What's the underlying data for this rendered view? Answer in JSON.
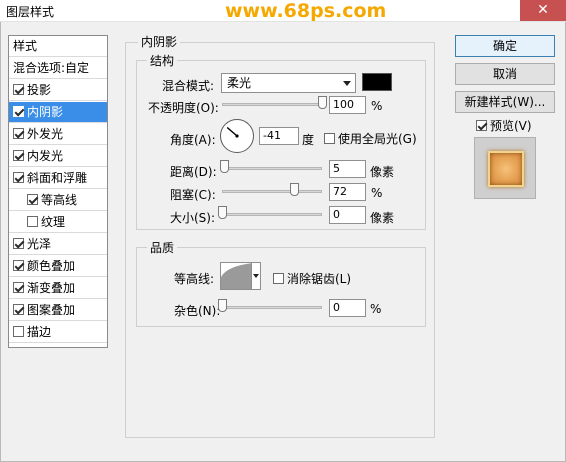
{
  "window": {
    "title": "图层样式",
    "watermark": "www.68ps.com",
    "close_label": "✕"
  },
  "left_panel": {
    "items": [
      {
        "label": "样式",
        "checkbox": false,
        "checked": false,
        "selected": false,
        "indent": false
      },
      {
        "label": "混合选项:自定",
        "checkbox": false,
        "checked": false,
        "selected": false,
        "indent": false
      },
      {
        "label": "投影",
        "checkbox": true,
        "checked": true,
        "selected": false,
        "indent": false
      },
      {
        "label": "内阴影",
        "checkbox": true,
        "checked": true,
        "selected": true,
        "indent": false
      },
      {
        "label": "外发光",
        "checkbox": true,
        "checked": true,
        "selected": false,
        "indent": false
      },
      {
        "label": "内发光",
        "checkbox": true,
        "checked": true,
        "selected": false,
        "indent": false
      },
      {
        "label": "斜面和浮雕",
        "checkbox": true,
        "checked": true,
        "selected": false,
        "indent": false
      },
      {
        "label": "等高线",
        "checkbox": true,
        "checked": true,
        "selected": false,
        "indent": true
      },
      {
        "label": "纹理",
        "checkbox": true,
        "checked": false,
        "selected": false,
        "indent": true
      },
      {
        "label": "光泽",
        "checkbox": true,
        "checked": true,
        "selected": false,
        "indent": false
      },
      {
        "label": "颜色叠加",
        "checkbox": true,
        "checked": true,
        "selected": false,
        "indent": false
      },
      {
        "label": "渐变叠加",
        "checkbox": true,
        "checked": true,
        "selected": false,
        "indent": false
      },
      {
        "label": "图案叠加",
        "checkbox": true,
        "checked": true,
        "selected": false,
        "indent": false
      },
      {
        "label": "描边",
        "checkbox": true,
        "checked": false,
        "selected": false,
        "indent": false
      }
    ]
  },
  "inner_shadow": {
    "group_title": "内阴影",
    "structure": {
      "title": "结构",
      "blend_mode_label": "混合模式:",
      "blend_mode_value": "柔光",
      "color": "#000000",
      "opacity_label": "不透明度(O):",
      "opacity_value": "100",
      "opacity_unit": "%",
      "opacity_level": 1.0,
      "angle_label": "角度(A):",
      "angle_value": "-41",
      "angle_unit": "度",
      "angle_degrees": -41,
      "global_light_label": "使用全局光(G)",
      "global_light_checked": false,
      "distance_label": "距离(D):",
      "distance_value": "5",
      "distance_unit": "像素",
      "distance_level": 0.02,
      "choke_label": "阻塞(C):",
      "choke_value": "72",
      "choke_unit": "%",
      "choke_level": 0.72,
      "size_label": "大小(S):",
      "size_value": "0",
      "size_unit": "像素",
      "size_level": 0.0
    },
    "quality": {
      "title": "品质",
      "contour_label": "等高线:",
      "anti_alias_label": "消除锯齿(L)",
      "anti_alias_checked": false,
      "noise_label": "杂色(N):",
      "noise_value": "0",
      "noise_unit": "%",
      "noise_level": 0.0
    }
  },
  "buttons": {
    "ok": "确定",
    "cancel": "取消",
    "new_style": "新建样式(W)...",
    "preview_label": "预览(V)",
    "preview_checked": true
  }
}
